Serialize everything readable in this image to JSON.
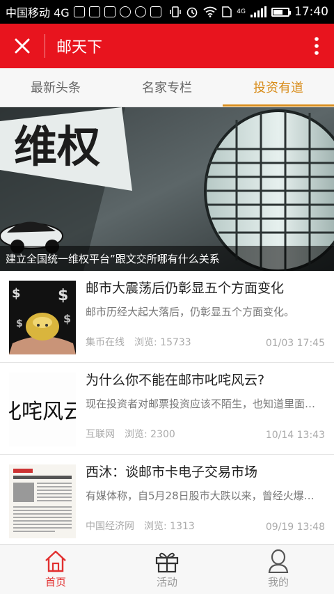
{
  "status_bar": {
    "carrier": "中国移动 4G",
    "network": "4G",
    "time": "17:40"
  },
  "header": {
    "title": "邮天下",
    "close_icon": "close-icon",
    "more_icon": "more-vertical-icon",
    "background_color": "#e8141e"
  },
  "tabs": [
    {
      "label": "最新头条",
      "active": false
    },
    {
      "label": "名家专栏",
      "active": false
    },
    {
      "label": "投资有道",
      "active": true
    }
  ],
  "accent_color": "#d88c1a",
  "banner": {
    "image_text": "维权",
    "caption": "建立全国统一维权平台”跟文交所哪有什么关系"
  },
  "articles": [
    {
      "title": "邮市大震荡后仍彰显五个方面变化",
      "summary": "邮市历经大起大落后，仍彰显五个方面变化。",
      "source": "集币在线",
      "views": "浏览: 15733",
      "time": "01/03 17:45"
    },
    {
      "title": "为什么你不能在邮市叱咤风云?",
      "summary": "现在投资者对邮票投资应该不陌生，也知道里面…",
      "source": "互联网",
      "views": "浏览: 2300",
      "time": "10/14 13:43",
      "thumb_text": "叱咤风云"
    },
    {
      "title": "西沐：谈邮市卡电子交易市场",
      "summary": "有媒体称，自5月28日股市大跌以来，曾经火爆…",
      "source": "中国经济网",
      "views": "浏览: 1313",
      "time": "09/19 13:48"
    }
  ],
  "bottom_nav": [
    {
      "label": "首页",
      "icon": "home-icon",
      "active": true
    },
    {
      "label": "活动",
      "icon": "gift-icon",
      "active": false
    },
    {
      "label": "我的",
      "icon": "user-icon",
      "active": false
    }
  ]
}
